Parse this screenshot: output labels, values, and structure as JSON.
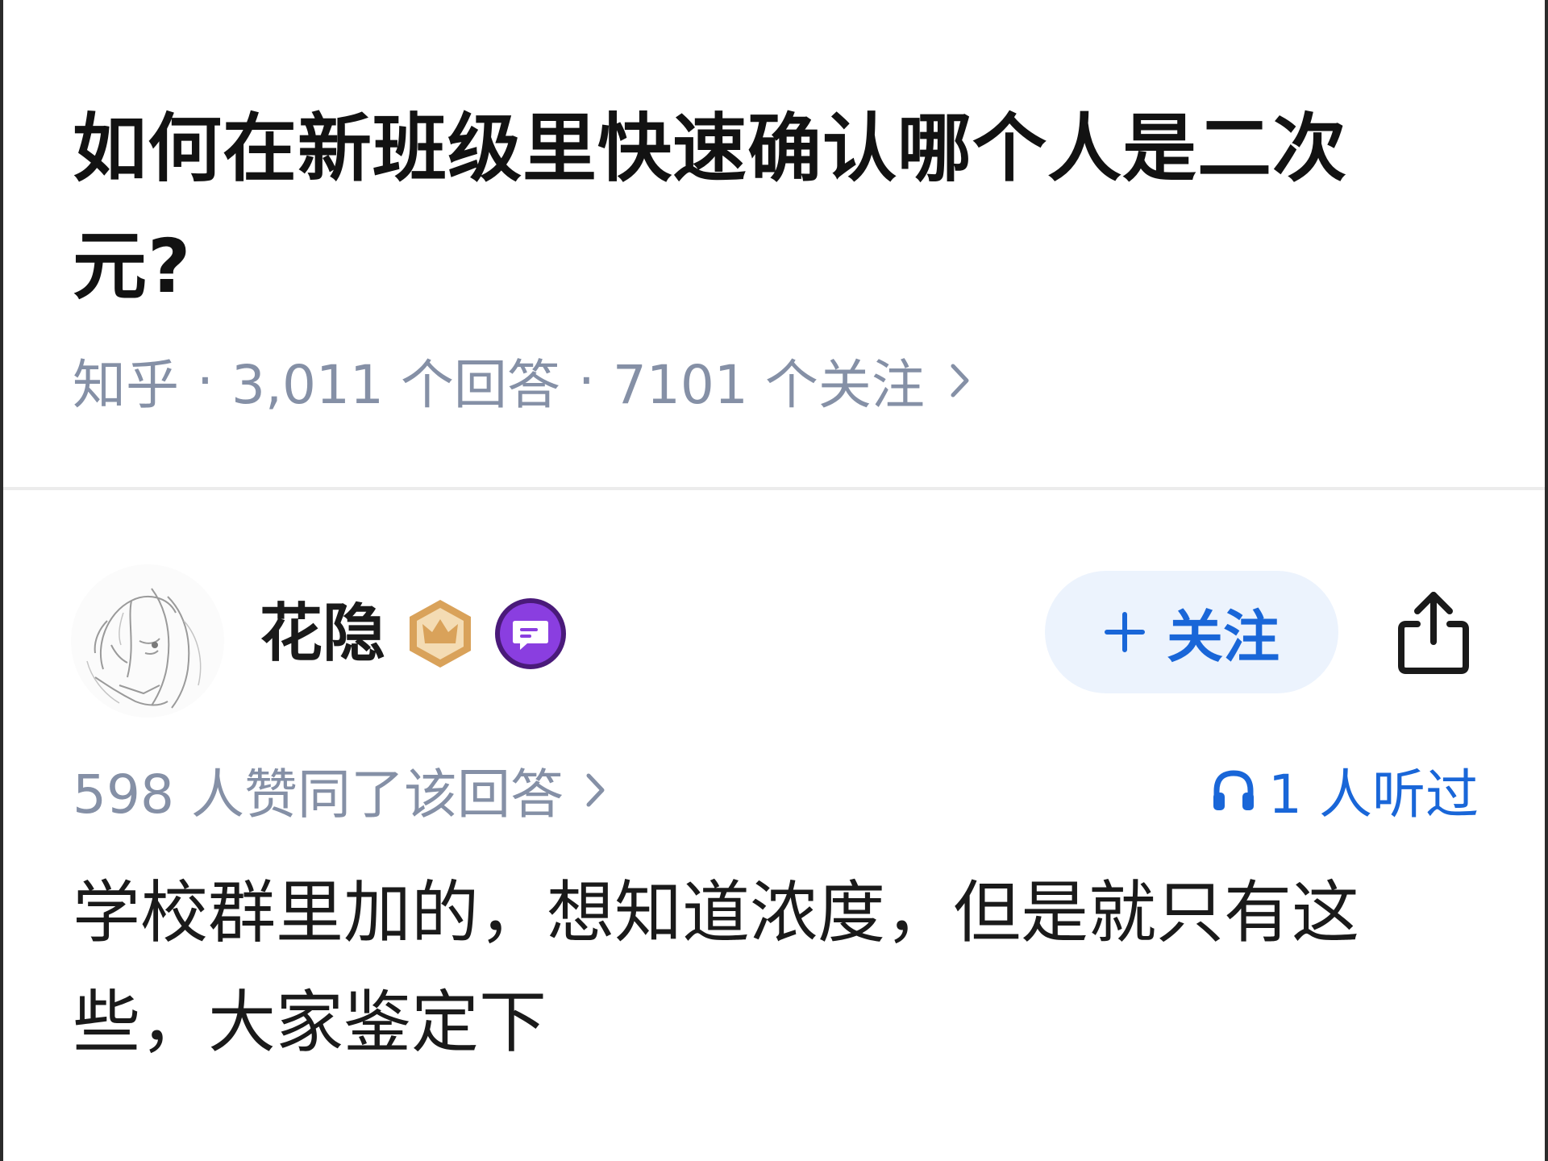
{
  "question": {
    "title": "如何在新班级里快速确认哪个人是二次元?",
    "meta": {
      "source": "知乎",
      "separator": "·",
      "answers": "3,011 个回答",
      "followers": "7101 个关注"
    }
  },
  "author": {
    "name": "花隐",
    "badges": [
      {
        "icon": "crown-badge-icon",
        "color": "#d9a25a"
      },
      {
        "icon": "comment-badge-icon",
        "color": "#8a3ee0"
      }
    ],
    "follow_label": "关注",
    "share_icon": "share-icon"
  },
  "answer": {
    "upvotes_text": "598 人赞同了该回答",
    "listen_text": "1 人听过",
    "body": "学校群里加的，想知道浓度，但是就只有这些，大家鉴定下"
  },
  "colors": {
    "accent": "#1966d8",
    "follow_bg": "#ecf3fd",
    "meta_gray": "#8590a6"
  }
}
